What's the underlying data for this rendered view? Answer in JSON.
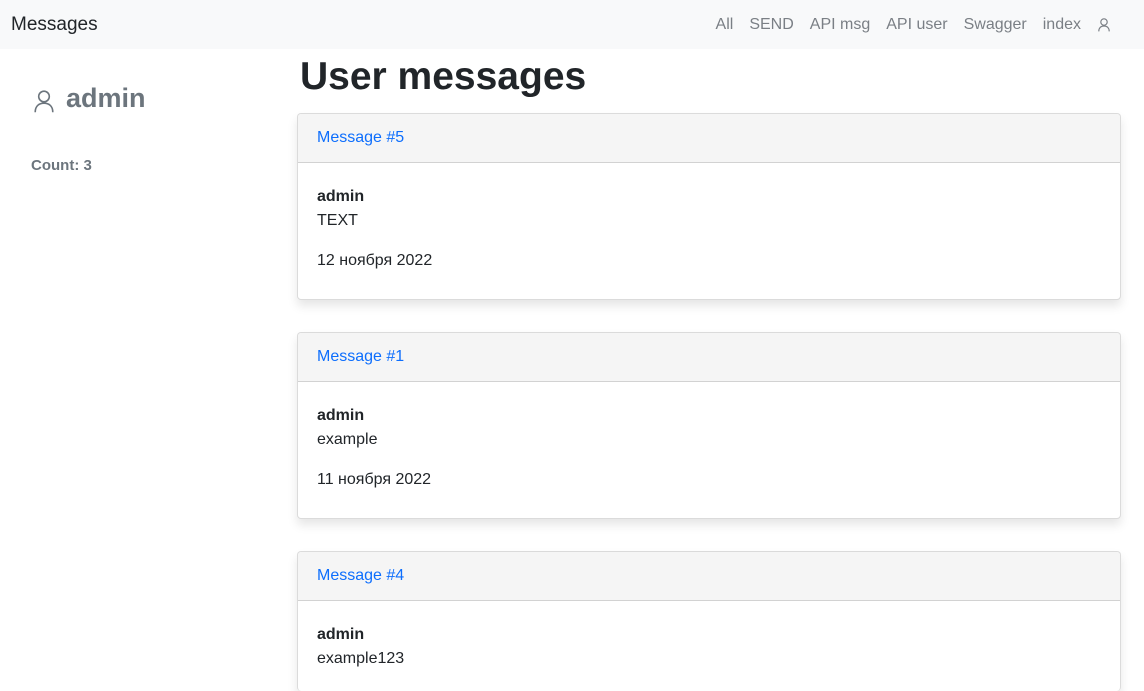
{
  "navbar": {
    "brand": "Messages",
    "links": [
      "All",
      "SEND",
      "API msg",
      "API user",
      "Swagger",
      "index"
    ],
    "user_icon": "user-icon"
  },
  "sidebar": {
    "profile_icon": "user-icon",
    "username": "admin",
    "count_text": "Count: 3"
  },
  "main": {
    "title": "User messages",
    "messages": [
      {
        "link": "Message #5",
        "author": "admin",
        "text": "TEXT",
        "date": "12 ноября 2022"
      },
      {
        "link": "Message #1",
        "author": "admin",
        "text": "example",
        "date": "11 ноября 2022"
      },
      {
        "link": "Message #4",
        "author": "admin",
        "text": "example123",
        "date": ""
      }
    ]
  },
  "colors": {
    "navbar_bg": "#f8f9fa",
    "link": "#0d6efd",
    "muted": "#6c757d"
  }
}
